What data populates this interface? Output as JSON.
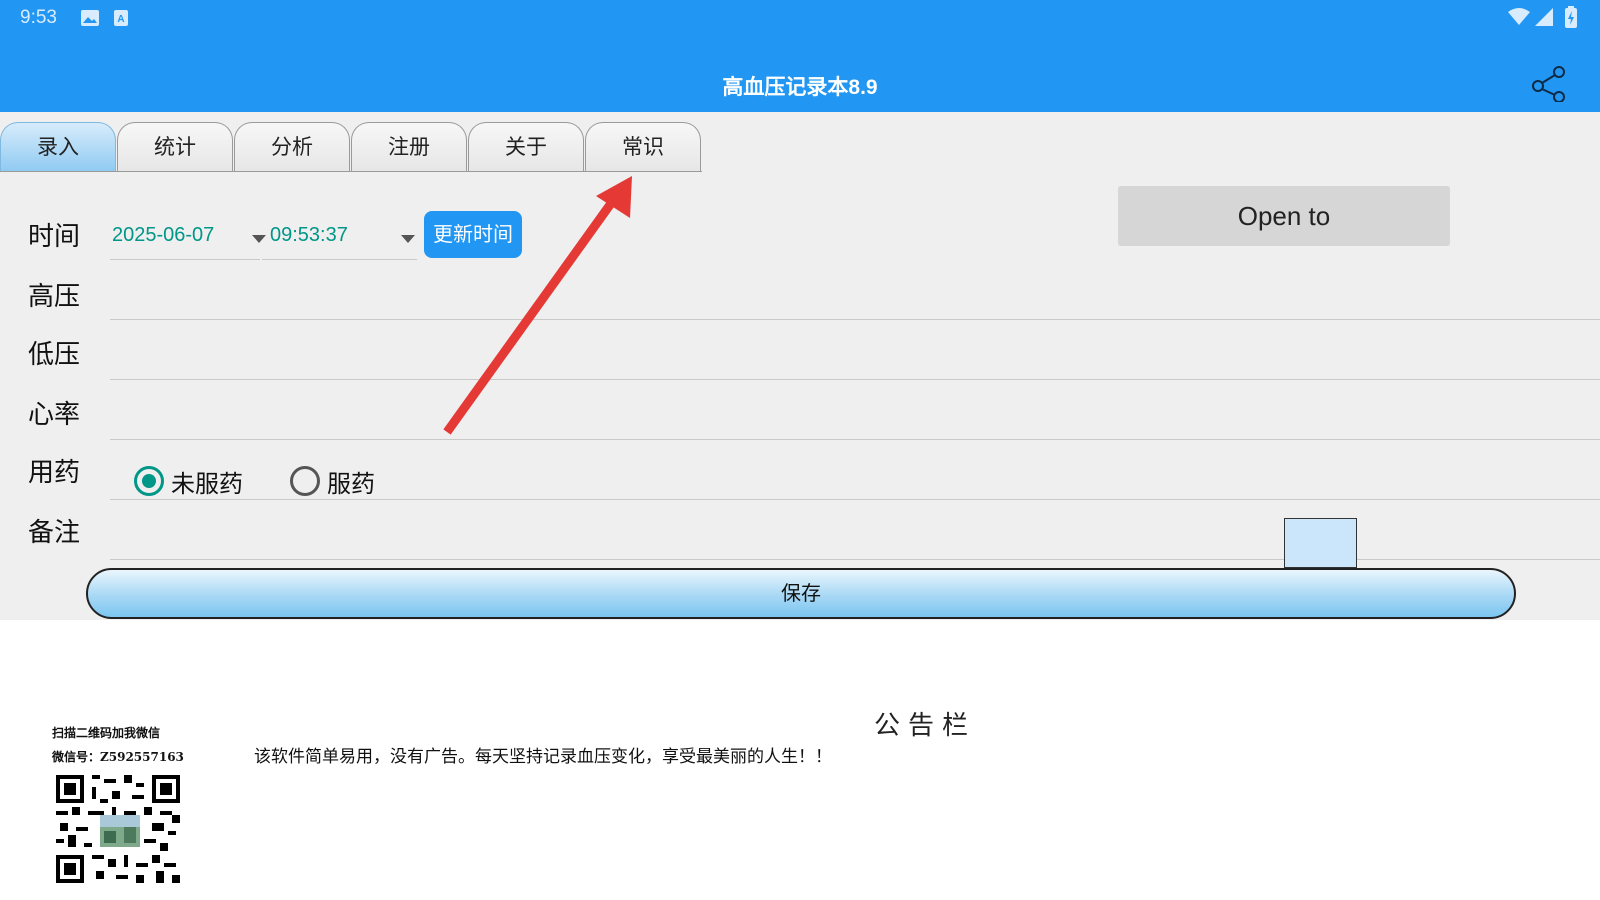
{
  "status_bar": {
    "time": "9:53",
    "icons": [
      "image-icon",
      "a-notification-icon",
      "wifi-icon",
      "signal-icon",
      "battery-icon"
    ]
  },
  "app_bar": {
    "title": "高血压记录本8.9",
    "share_icon": "share-icon"
  },
  "tabs": [
    {
      "label": "录入",
      "active": true
    },
    {
      "label": "统计",
      "active": false
    },
    {
      "label": "分析",
      "active": false
    },
    {
      "label": "注册",
      "active": false
    },
    {
      "label": "关于",
      "active": false
    },
    {
      "label": "常识",
      "active": false
    }
  ],
  "form": {
    "time_label": "时间",
    "date_value": "2025-06-07",
    "time_value": "09:53:37",
    "update_time_button": "更新时间",
    "open_to_button": "Open to",
    "systolic_label": "高压",
    "systolic_value": "",
    "diastolic_label": "低压",
    "diastolic_value": "",
    "heart_rate_label": "心率",
    "heart_rate_value": "",
    "medication_label": "用药",
    "medication_options": [
      {
        "label": "未服药",
        "checked": true
      },
      {
        "label": "服药",
        "checked": false
      }
    ],
    "note_label": "备注",
    "note_value": "",
    "save_button": "保存"
  },
  "bulletin": {
    "title": "公告栏",
    "text": "该软件简单易用，没有广告。每天坚持记录血压变化，享受最美丽的人生！！",
    "qr_caption_1": "扫描二维码加我微信",
    "qr_caption_2": "微信号：Z592557163"
  },
  "colors": {
    "app_bar": "#2196f3",
    "accent": "#009688",
    "annotation_arrow": "#e53935"
  }
}
